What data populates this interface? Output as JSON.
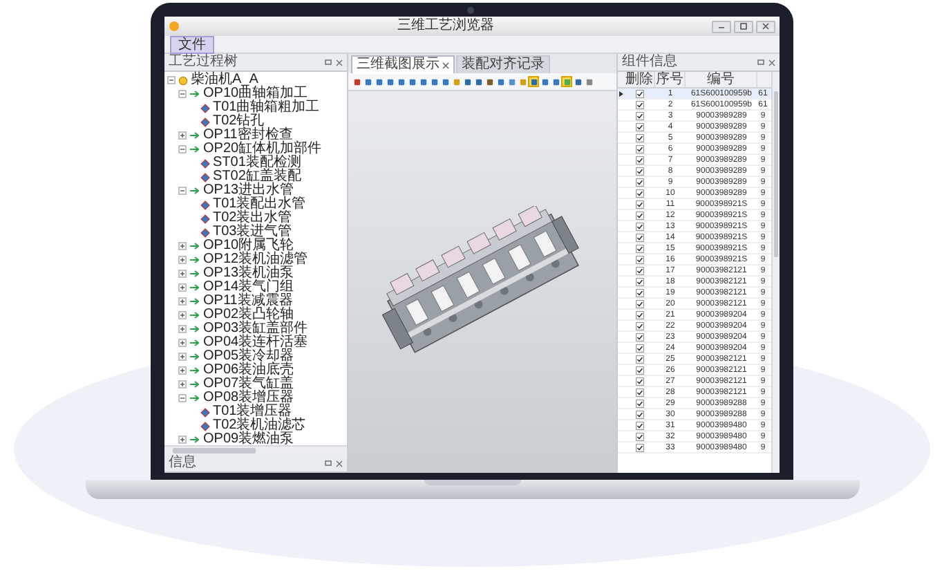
{
  "window": {
    "title": "三维工艺浏览器"
  },
  "menu": [
    {
      "label": "文件",
      "selected": true
    }
  ],
  "tree_panel": {
    "title": "工艺过程树",
    "items": [
      {
        "label": "柴油机A_A",
        "expanded": true,
        "children": [
          {
            "label": "OP10曲轴箱加工",
            "expanded": true,
            "children": [
              {
                "label": "T01曲轴箱粗加工"
              },
              {
                "label": "T02钻孔"
              }
            ]
          },
          {
            "label": "OP11密封检查",
            "expanded": false
          },
          {
            "label": "OP20缸体机加部件",
            "expanded": true,
            "children": [
              {
                "label": "ST01装配检测"
              },
              {
                "label": "ST02缸盖装配"
              }
            ]
          },
          {
            "label": "OP13进出水管",
            "expanded": true,
            "children": [
              {
                "label": "T01装配出水管"
              },
              {
                "label": "T02装出水管"
              },
              {
                "label": "T03装进气管"
              }
            ]
          },
          {
            "label": "OP10附属飞轮",
            "expanded": false
          },
          {
            "label": "OP12装机油滤管",
            "expanded": false
          },
          {
            "label": "OP13装机油泵",
            "expanded": false
          },
          {
            "label": "OP14装气门组",
            "expanded": false
          },
          {
            "label": "OP11装减震器",
            "expanded": false
          },
          {
            "label": "OP02装凸轮轴",
            "expanded": false
          },
          {
            "label": "OP03装缸盖部件",
            "expanded": false
          },
          {
            "label": "OP04装连杆活塞",
            "expanded": false
          },
          {
            "label": "OP05装冷却器",
            "expanded": false
          },
          {
            "label": "OP06装油底壳",
            "expanded": false
          },
          {
            "label": "OP07装气缸盖",
            "expanded": false
          },
          {
            "label": "OP08装增压器",
            "expanded": true,
            "children": [
              {
                "label": "T01装增压器"
              },
              {
                "label": "T02装机油滤芯"
              }
            ]
          },
          {
            "label": "OP09装燃油泵",
            "expanded": false
          }
        ]
      }
    ]
  },
  "info_panel": {
    "title": "信息"
  },
  "tabs": [
    {
      "label": "三维截图展示",
      "selected": true,
      "closable": true
    },
    {
      "label": "装配对齐记录",
      "selected": false,
      "closable": false
    }
  ],
  "toolbar": [
    {
      "selected": false
    },
    {
      "selected": false
    },
    {
      "selected": false
    },
    {
      "selected": false
    },
    {
      "selected": false
    },
    {
      "selected": false
    },
    {
      "selected": false
    },
    {
      "selected": false
    },
    {
      "selected": false
    },
    {
      "selected": false
    },
    {
      "selected": false
    },
    {
      "selected": false
    },
    {
      "selected": false
    },
    {
      "selected": false
    },
    {
      "selected": false
    },
    {
      "selected": false
    },
    {
      "selected": true
    },
    {
      "selected": false
    },
    {
      "selected": false
    },
    {
      "selected": true
    },
    {
      "selected": false
    },
    {
      "selected": false
    }
  ],
  "parts_panel": {
    "title": "组件信息",
    "columns": [
      "删除",
      "序号",
      "编号"
    ],
    "rows": [
      {
        "checked": true,
        "selected": true,
        "index": "1",
        "code": "61S600100959b",
        "column_3": "61"
      },
      {
        "checked": true,
        "selected": false,
        "index": "2",
        "code": "61S600100959b",
        "column_3": "61"
      },
      {
        "checked": true,
        "selected": false,
        "index": "3",
        "code": "90003989289",
        "column_3": "9"
      },
      {
        "checked": true,
        "selected": false,
        "index": "4",
        "code": "90003989289",
        "column_3": "9"
      },
      {
        "checked": true,
        "selected": false,
        "index": "5",
        "code": "90003989289",
        "column_3": "9"
      },
      {
        "checked": true,
        "selected": false,
        "index": "6",
        "code": "90003989289",
        "column_3": "9"
      },
      {
        "checked": true,
        "selected": false,
        "index": "7",
        "code": "90003989289",
        "column_3": "9"
      },
      {
        "checked": true,
        "selected": false,
        "index": "8",
        "code": "90003989289",
        "column_3": "9"
      },
      {
        "checked": true,
        "selected": false,
        "index": "9",
        "code": "90003989289",
        "column_3": "9"
      },
      {
        "checked": true,
        "selected": false,
        "index": "10",
        "code": "90003989289",
        "column_3": "9"
      },
      {
        "checked": true,
        "selected": false,
        "index": "11",
        "code": "9000398921S",
        "column_3": "9"
      },
      {
        "checked": true,
        "selected": false,
        "index": "12",
        "code": "9000398921S",
        "column_3": "9"
      },
      {
        "checked": true,
        "selected": false,
        "index": "13",
        "code": "9000398921S",
        "column_3": "9"
      },
      {
        "checked": true,
        "selected": false,
        "index": "14",
        "code": "9000398921S",
        "column_3": "9"
      },
      {
        "checked": true,
        "selected": false,
        "index": "15",
        "code": "9000398921S",
        "column_3": "9"
      },
      {
        "checked": true,
        "selected": false,
        "index": "16",
        "code": "9000398921S",
        "column_3": "9"
      },
      {
        "checked": true,
        "selected": false,
        "index": "17",
        "code": "90003982121",
        "column_3": "9"
      },
      {
        "checked": true,
        "selected": false,
        "index": "18",
        "code": "90003982121",
        "column_3": "9"
      },
      {
        "checked": true,
        "selected": false,
        "index": "19",
        "code": "90003982121",
        "column_3": "9"
      },
      {
        "checked": true,
        "selected": false,
        "index": "20",
        "code": "90003982121",
        "column_3": "9"
      },
      {
        "checked": true,
        "selected": false,
        "index": "21",
        "code": "90003989204",
        "column_3": "9"
      },
      {
        "checked": true,
        "selected": false,
        "index": "22",
        "code": "90003989204",
        "column_3": "9"
      },
      {
        "checked": true,
        "selected": false,
        "index": "23",
        "code": "90003989204",
        "column_3": "9"
      },
      {
        "checked": true,
        "selected": false,
        "index": "24",
        "code": "90003989204",
        "column_3": "9"
      },
      {
        "checked": true,
        "selected": false,
        "index": "25",
        "code": "90003982121",
        "column_3": "9"
      },
      {
        "checked": true,
        "selected": false,
        "index": "26",
        "code": "90003982121",
        "column_3": "9"
      },
      {
        "checked": true,
        "selected": false,
        "index": "27",
        "code": "90003982121",
        "column_3": "9"
      },
      {
        "checked": true,
        "selected": false,
        "index": "28",
        "code": "90003982121",
        "column_3": "9"
      },
      {
        "checked": true,
        "selected": false,
        "index": "29",
        "code": "90003989288",
        "column_3": "9"
      },
      {
        "checked": true,
        "selected": false,
        "index": "30",
        "code": "90003989288",
        "column_3": "9"
      },
      {
        "checked": true,
        "selected": false,
        "index": "31",
        "code": "90003989480",
        "column_3": "9"
      },
      {
        "checked": true,
        "selected": false,
        "index": "32",
        "code": "90003989480",
        "column_3": "9"
      },
      {
        "checked": true,
        "selected": false,
        "index": "33",
        "code": "90003989480",
        "column_3": "9"
      }
    ]
  }
}
